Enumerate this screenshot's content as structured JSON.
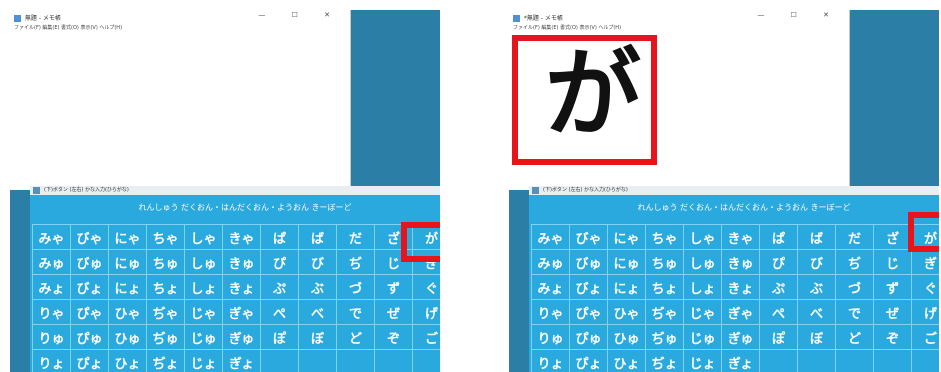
{
  "screens": [
    {
      "notepad": {
        "title": "無題 - メモ帳",
        "window_controls": "— ☐ ✕",
        "menu": "ファイル(F)  編集(E)  書式(O)  表示(V)  ヘルプ(H)",
        "text": ""
      },
      "keyboard": {
        "title": "(下)ボタン  (左右)  かな入力(ひらがな)",
        "close": "✕",
        "header": "れんしゅう  だくおん・はんだくおん・ようおん  きーぼーど",
        "rows": [
          [
            "みゃ",
            "びゃ",
            "にゃ",
            "ちゃ",
            "しゃ",
            "きゃ",
            "ぱ",
            "ば",
            "だ",
            "ざ",
            "が"
          ],
          [
            "みゅ",
            "びゅ",
            "にゅ",
            "ちゅ",
            "しゅ",
            "きゅ",
            "ぴ",
            "び",
            "ぢ",
            "じ",
            "ぎ"
          ],
          [
            "みょ",
            "びょ",
            "にょ",
            "ちょ",
            "しょ",
            "きょ",
            "ぷ",
            "ぶ",
            "づ",
            "ず",
            "ぐ"
          ],
          [
            "りゃ",
            "ぴゃ",
            "ひゃ",
            "ぢゃ",
            "じゃ",
            "ぎゃ",
            "ぺ",
            "べ",
            "で",
            "ぜ",
            "げ"
          ],
          [
            "りゅ",
            "ぴゅ",
            "ひゅ",
            "ぢゅ",
            "じゅ",
            "ぎゅ",
            "ぽ",
            "ぼ",
            "ど",
            "ぞ",
            "ご"
          ],
          [
            "りょ",
            "ぴょ",
            "ひょ",
            "ぢょ",
            "じょ",
            "ぎょ",
            "",
            "",
            "",
            "",
            ""
          ]
        ]
      }
    },
    {
      "notepad": {
        "title": "*無題 - メモ帳",
        "window_controls": "— ☐ ✕",
        "menu": "ファイル(F)  編集(E)  書式(O)  表示(V)  ヘルプ(H)",
        "text": "が"
      },
      "keyboard": {
        "title": "(下)ボタン  (左右)  かな入力(ひらがな)",
        "close": "✕",
        "header": "れんしゅう  だくおん・はんだくおん・ようおん  きーぼーど",
        "rows": [
          [
            "みゃ",
            "びゃ",
            "にゃ",
            "ちゃ",
            "しゃ",
            "きゃ",
            "ぱ",
            "ば",
            "だ",
            "ざ",
            "が"
          ],
          [
            "みゅ",
            "びゅ",
            "にゅ",
            "ちゅ",
            "しゅ",
            "きゅ",
            "ぴ",
            "び",
            "ぢ",
            "じ",
            "ぎ"
          ],
          [
            "みょ",
            "びょ",
            "にょ",
            "ちょ",
            "しょ",
            "きょ",
            "ぷ",
            "ぶ",
            "づ",
            "ず",
            "ぐ"
          ],
          [
            "りゃ",
            "ぴゃ",
            "ひゃ",
            "ぢゃ",
            "じゃ",
            "ぎゃ",
            "ぺ",
            "べ",
            "で",
            "ぜ",
            "げ"
          ],
          [
            "りゅ",
            "ぴゅ",
            "ひゅ",
            "ぢゅ",
            "じゅ",
            "ぎゅ",
            "ぽ",
            "ぼ",
            "ど",
            "ぞ",
            "ご"
          ],
          [
            "りょ",
            "ぴょ",
            "ひょ",
            "ぢょ",
            "じょ",
            "ぎょ",
            "",
            "",
            "",
            "",
            ""
          ]
        ]
      }
    }
  ],
  "colors": {
    "highlight": "#e8141b",
    "keyboard_bg": "#29a9de",
    "desktop_bg": "#2b7fa6"
  }
}
